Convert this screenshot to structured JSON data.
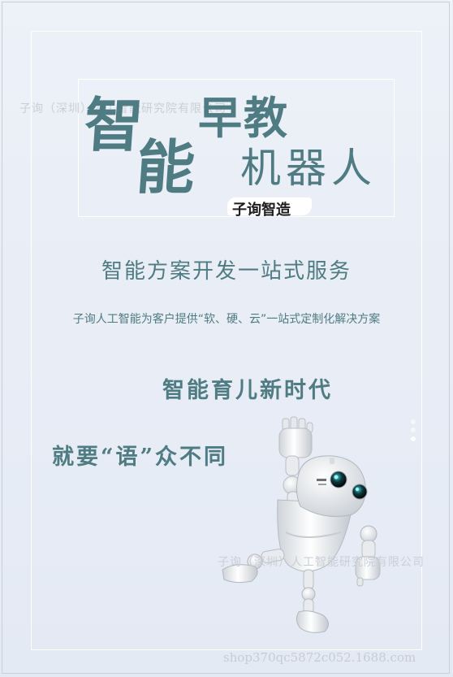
{
  "title": {
    "zhi": "智",
    "neng": "能",
    "zaojiao": "早教",
    "jiqiren": "机器人",
    "brand_mark": "子询智造"
  },
  "slogan": "智能方案开发一站式服务",
  "description": "子询人工智能为客户提供“软、硬、云”一站式定制化解决方案",
  "era_line": "智能育儿新时代",
  "catchphrase": "就要“语”众不同",
  "watermarks": {
    "top": "子询（深圳）人工智能研究院有限公司",
    "bottom": "子询（深圳）人工智能研究院有限公司",
    "url": "shop370qc5872c052.1688.com"
  },
  "colors": {
    "accent": "#4f7b82",
    "background": "#e9eef6"
  },
  "icons": {
    "robot": "robot-illustration"
  }
}
